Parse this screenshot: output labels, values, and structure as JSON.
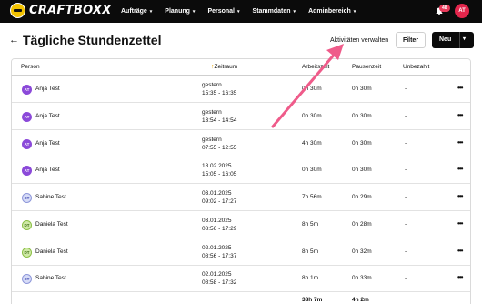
{
  "app": {
    "logo_text": "CRAFTBOXX"
  },
  "nav": {
    "items": [
      {
        "label": "Aufträge"
      },
      {
        "label": "Planung"
      },
      {
        "label": "Personal"
      },
      {
        "label": "Stammdaten"
      },
      {
        "label": "Adminbereich"
      }
    ],
    "caret": "▾",
    "notification_count": "48",
    "user_initials": "AT"
  },
  "header": {
    "back_icon": "←",
    "title": "Tägliche Stundenzettel",
    "activities_link": "Aktivitäten verwalten",
    "filter_label": "Filter",
    "new_label": "Neu",
    "new_caret": "▾"
  },
  "table": {
    "columns": {
      "person": "Person",
      "sort_icon": "↑",
      "period": "Zeitraum",
      "work": "Arbeitszeit",
      "break": "Pausenzeit",
      "unpaid": "Unbezahlt"
    },
    "rows": [
      {
        "initials": "AT",
        "avatar": "at",
        "name": "Anja Test",
        "date": "gestern",
        "time": "15:35 - 16:35",
        "work": "0h 30m",
        "break": "0h 30m",
        "unpaid": "-"
      },
      {
        "initials": "AT",
        "avatar": "at",
        "name": "Anja Test",
        "date": "gestern",
        "time": "13:54 - 14:54",
        "work": "0h 30m",
        "break": "0h 30m",
        "unpaid": "-"
      },
      {
        "initials": "AT",
        "avatar": "at",
        "name": "Anja Test",
        "date": "gestern",
        "time": "07:55 - 12:55",
        "work": "4h 30m",
        "break": "0h 30m",
        "unpaid": "-"
      },
      {
        "initials": "AT",
        "avatar": "at",
        "name": "Anja Test",
        "date": "18.02.2025",
        "time": "15:05 - 16:05",
        "work": "0h 30m",
        "break": "0h 30m",
        "unpaid": "-"
      },
      {
        "initials": "ST",
        "avatar": "st",
        "name": "Sabine Test",
        "date": "03.01.2025",
        "time": "09:02 - 17:27",
        "work": "7h 56m",
        "break": "0h 29m",
        "unpaid": "-"
      },
      {
        "initials": "DT",
        "avatar": "dt",
        "name": "Daniela Test",
        "date": "03.01.2025",
        "time": "08:56 - 17:29",
        "work": "8h 5m",
        "break": "0h 28m",
        "unpaid": "-"
      },
      {
        "initials": "DT",
        "avatar": "dt",
        "name": "Daniela Test",
        "date": "02.01.2025",
        "time": "08:56 - 17:37",
        "work": "8h 5m",
        "break": "0h 32m",
        "unpaid": "-"
      },
      {
        "initials": "ST",
        "avatar": "st",
        "name": "Sabine Test",
        "date": "02.01.2025",
        "time": "08:58 - 17:32",
        "work": "8h 1m",
        "break": "0h 33m",
        "unpaid": "-"
      }
    ],
    "row_menu": "•••",
    "totals": {
      "work": "38h 7m",
      "break": "4h 2m"
    }
  },
  "colors": {
    "topbar": "#0b0b0b",
    "accent_arrow": "#ef5b8a",
    "sort_icon": "#e8a400",
    "notification": "#e83a5a"
  }
}
